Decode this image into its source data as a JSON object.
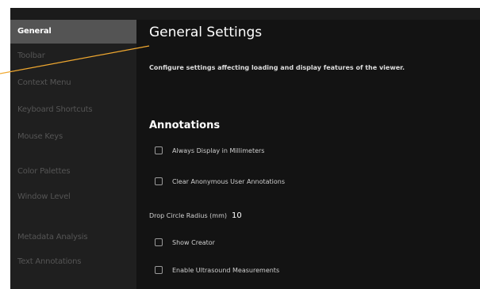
{
  "sidebar": {
    "items": [
      {
        "label": "General",
        "active": true
      },
      {
        "label": "Toolbar",
        "active": false
      },
      {
        "label": "Context Menu",
        "active": false
      },
      {
        "label": "Keyboard Shortcuts",
        "active": false
      },
      {
        "label": "Mouse Keys",
        "active": false
      },
      {
        "label": "Color Palettes",
        "active": false
      },
      {
        "label": "Window Level",
        "active": false
      },
      {
        "label": "Metadata Analysis",
        "active": false
      },
      {
        "label": "Text Annotations",
        "active": false
      }
    ]
  },
  "main": {
    "title": "General Settings",
    "subtitle": "Configure settings affecting loading and display features of the viewer.",
    "annotations": {
      "heading": "Annotations",
      "options": [
        {
          "label": "Always Display in Millimeters",
          "checked": false
        },
        {
          "label": "Clear Anonymous User Annotations",
          "checked": false
        },
        {
          "label": "Show Creator",
          "checked": false
        },
        {
          "label": "Enable Ultrasound Measurements",
          "checked": false
        }
      ],
      "drop_circle_radius": {
        "label": "Drop Circle Radius (mm)",
        "value": "10"
      }
    }
  },
  "colors": {
    "active_item_bg": "#545454",
    "callout_line": "#f0a830"
  }
}
